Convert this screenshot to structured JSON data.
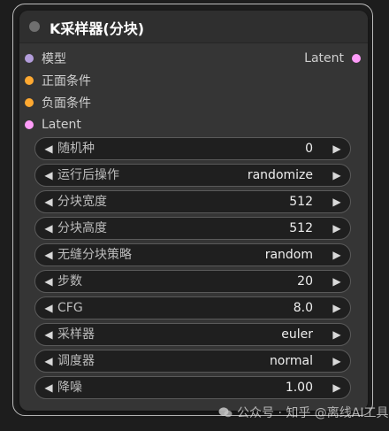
{
  "node": {
    "title": "K采样器(分块)"
  },
  "inputs": [
    {
      "label": "模型",
      "color": "#b39ddb"
    },
    {
      "label": "正面条件",
      "color": "#ffa931"
    },
    {
      "label": "负面条件",
      "color": "#ffa931"
    },
    {
      "label": "Latent",
      "color": "#ff9cf9"
    }
  ],
  "outputs": [
    {
      "label": "Latent",
      "color": "#ff9cf9"
    }
  ],
  "widgets": [
    {
      "label": "随机种",
      "value": "0"
    },
    {
      "label": "运行后操作",
      "value": "randomize"
    },
    {
      "label": "分块宽度",
      "value": "512"
    },
    {
      "label": "分块高度",
      "value": "512"
    },
    {
      "label": "无缝分块策略",
      "value": "random"
    },
    {
      "label": "步数",
      "value": "20"
    },
    {
      "label": "CFG",
      "value": "8.0"
    },
    {
      "label": "采样器",
      "value": "euler"
    },
    {
      "label": "调度器",
      "value": "normal"
    },
    {
      "label": "降噪",
      "value": "1.00"
    }
  ],
  "arrows": {
    "left": "◀",
    "right": "▶"
  },
  "watermark": {
    "text": "公众号 · 知乎 @离线AI工具",
    "icon": "wechat-icon"
  }
}
